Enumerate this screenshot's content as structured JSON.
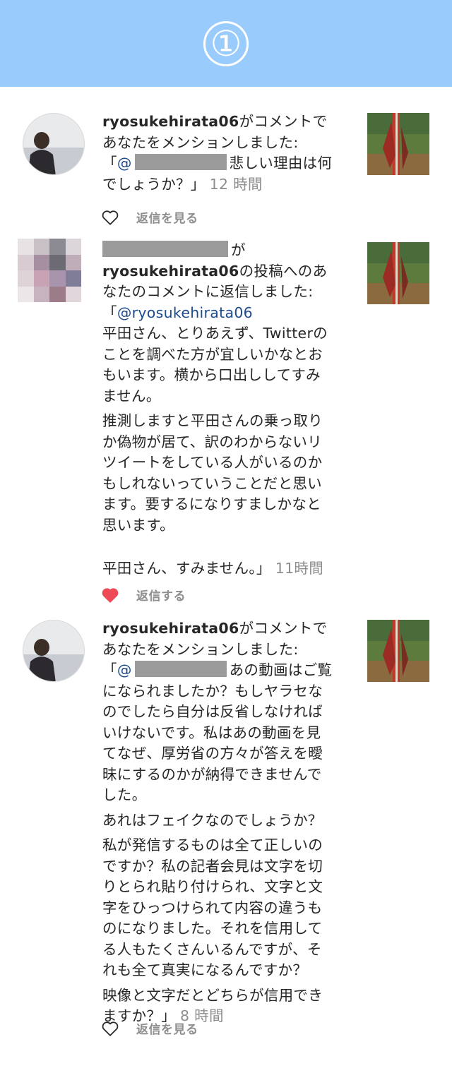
{
  "header": {
    "number": "①"
  },
  "notifications": [
    {
      "username": "ryosukehirata06",
      "line1_suffix": "がコメントで",
      "line2": "あなたをメンションしました:",
      "quote_open": "「",
      "mention_prefix": "@",
      "line3_rest": "悲しい理由は何",
      "line4": "でしょうか？」",
      "time": "12 時間",
      "action_label": "返信を見る",
      "liked": false
    },
    {
      "line1_suffix": "が",
      "username": "ryosukehirata06",
      "line2_suffix": "の投稿へのあ",
      "line3": "なたのコメントに返信しました:",
      "line4_open": "「",
      "mention": "@ryosukehirata06",
      "para1": [
        "平田さん、とりあえず、Twitterの",
        "ことを調べた方が宜しいかなとお",
        "もいます。横から口出ししてすみ",
        "ません。"
      ],
      "para2": [
        "推測しますと平田さんの乗っ取り",
        "か偽物が居て、訳のわからないリ",
        "ツイートをしている人がいるのか",
        "もしれないっていうことだと思い",
        "ます。要するになりすましかなと",
        "思います。"
      ],
      "last_line": "平田さん、すみません。」",
      "time": "11時間",
      "action_label": "返信する",
      "liked": true
    },
    {
      "username": "ryosukehirata06",
      "line1_suffix": "がコメントで",
      "line2": "あなたをメンションしました:",
      "quote_open": "「",
      "mention_prefix": "@",
      "line3_rest": "あの動画はご覧",
      "para1": [
        "になられましたか？もしヤラセな",
        "のでしたら自分は反省しなければ",
        "いけないです。私はあの動画を見",
        "てなぜ、厚労省の方々が答えを曖",
        "昧にするのかが納得できませんで",
        "した。"
      ],
      "para2": [
        "あれはフェイクなのでしょうか？"
      ],
      "para3": [
        "私が発信するものは全て正しいの",
        "ですか？私の記者会見は文字を切",
        "りとられ貼り付けられ、文字と文",
        "字をひっつけられて内容の違うも",
        "のになりました。それを信用して",
        "る人もたくさんいるんですが、そ",
        "れも全て真実になるんですか？"
      ],
      "para4": [
        "映像と文字だとどちらが信用でき"
      ],
      "last_line": "ますか？」",
      "time": "8 時間",
      "action_label": "返信を見る",
      "liked": false
    }
  ],
  "colors": {
    "banner": "#99cbfc",
    "mention": "#1e4b8d",
    "heart_liked": "#ed4956",
    "meta": "#8e8e8e"
  }
}
